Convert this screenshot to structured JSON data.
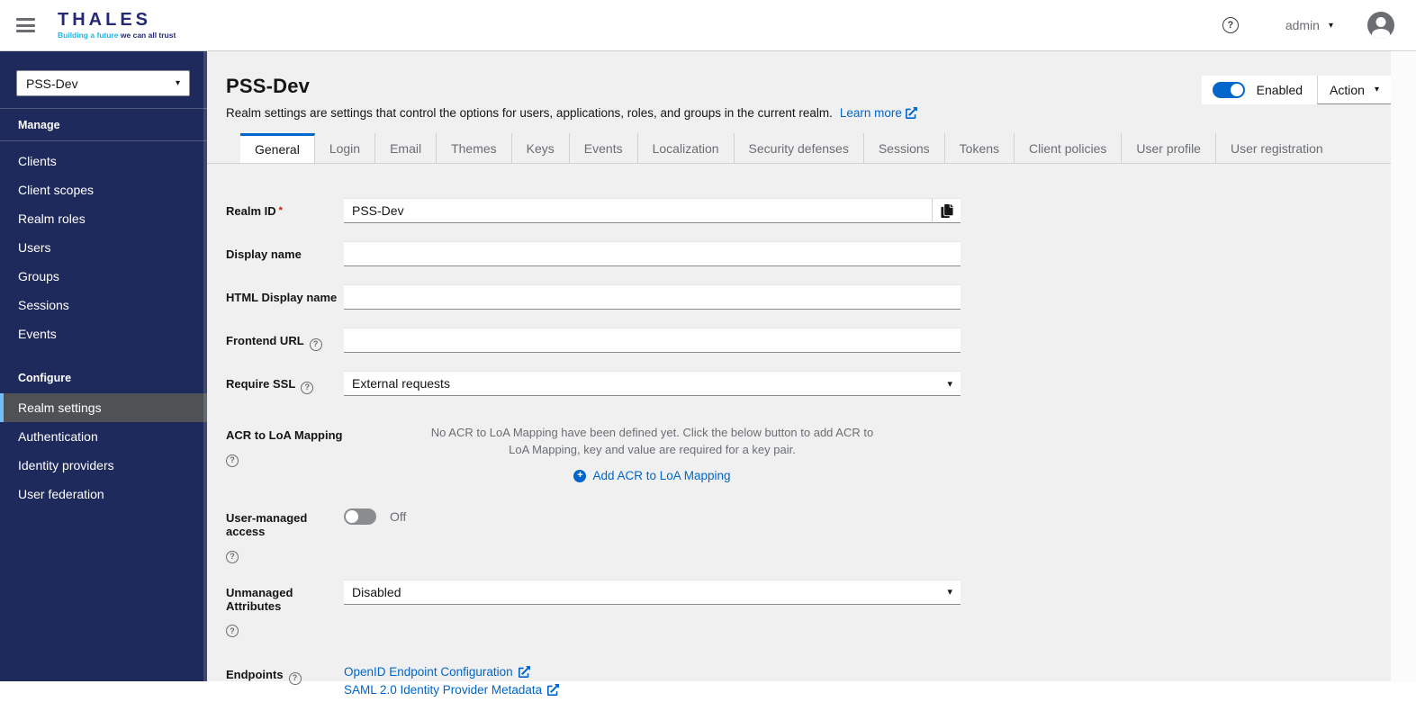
{
  "colors": {
    "accent": "#0066cc",
    "sidebar_bg": "#1f2a5c",
    "sidebar_active_bg": "#4f5255",
    "sidebar_active_border": "#73bcf7",
    "content_bg": "#f0f0f0",
    "link": "#0066cc",
    "toggle_on": "#0066cc",
    "toggle_off": "#8a8d90",
    "required_marker_color": "#c9190b",
    "brand_navy": "#242a75",
    "brand_cyan": "#26b3e8"
  },
  "icons": {
    "caret_down": "▾",
    "question_mark": "?",
    "plus": "+"
  },
  "topbar": {
    "brand_name": "THALES",
    "brand_tagline_highlight": "Building a future",
    "brand_tagline_rest": " we can all trust",
    "user_name": "admin"
  },
  "sidebar": {
    "realm_selector_value": "PSS-Dev",
    "section_manage": "Manage",
    "section_configure": "Configure",
    "manage_items": [
      "Clients",
      "Client scopes",
      "Realm roles",
      "Users",
      "Groups",
      "Sessions",
      "Events"
    ],
    "configure_items": [
      "Realm settings",
      "Authentication",
      "Identity providers",
      "User federation"
    ],
    "active_item": "Realm settings"
  },
  "page": {
    "title": "PSS-Dev",
    "description": "Realm settings are settings that control the options for users, applications, roles, and groups in the current realm.",
    "learn_more_label": "Learn more",
    "enabled_label": "Enabled",
    "action_label": "Action"
  },
  "tabs": [
    "General",
    "Login",
    "Email",
    "Themes",
    "Keys",
    "Events",
    "Localization",
    "Security defenses",
    "Sessions",
    "Tokens",
    "Client policies",
    "User profile",
    "User registration"
  ],
  "active_tab": "General",
  "form": {
    "realm_id": {
      "label": "Realm ID",
      "required_marker": "*",
      "value": "PSS-Dev"
    },
    "display_name": {
      "label": "Display name",
      "value": ""
    },
    "html_display_name": {
      "label": "HTML Display name",
      "value": ""
    },
    "frontend_url": {
      "label": "Frontend URL",
      "value": ""
    },
    "require_ssl": {
      "label": "Require SSL",
      "value": "External requests"
    },
    "acr_to_loa": {
      "label": "ACR to LoA Mapping",
      "empty_text": "No ACR to LoA Mapping have been defined yet. Click the below button to add ACR to LoA Mapping, key and value are required for a key pair.",
      "add_button_label": "Add ACR to LoA Mapping"
    },
    "user_managed_access": {
      "label": "User-managed access",
      "state_label": "Off"
    },
    "unmanaged_attributes": {
      "label": "Unmanaged Attributes",
      "value": "Disabled"
    },
    "endpoints": {
      "label": "Endpoints",
      "links": [
        "OpenID Endpoint Configuration",
        "SAML 2.0 Identity Provider Metadata"
      ]
    }
  }
}
